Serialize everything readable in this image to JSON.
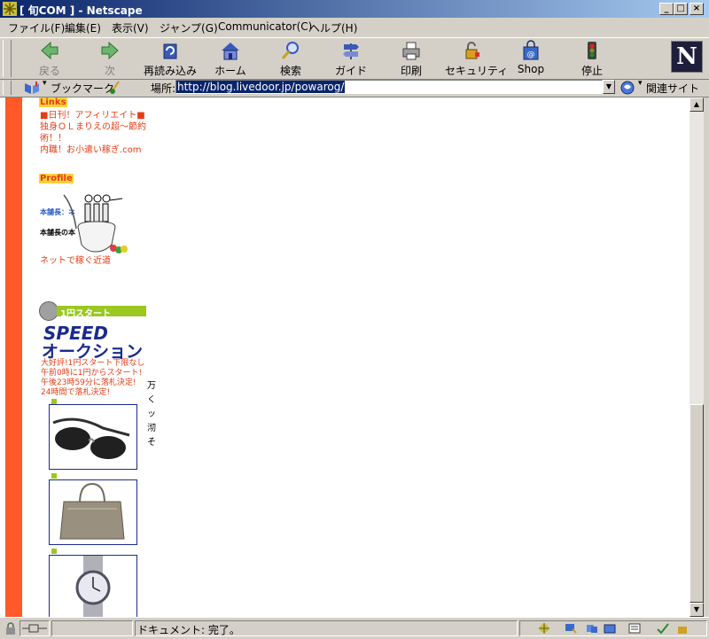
{
  "window": {
    "title": "[ 旬COM ] - Netscape"
  },
  "menu": [
    "ファイル(F)",
    "編集(E)",
    "表示(V)",
    "ジャンプ(G)",
    "Communicator(C)",
    "ヘルプ(H)"
  ],
  "toolbar": {
    "back": "戻る",
    "forward": "次",
    "reload": "再読み込み",
    "home": "ホーム",
    "search": "検索",
    "guide": "ガイド",
    "print": "印刷",
    "security": "セキュリティ",
    "shop": "Shop",
    "stop": "停止",
    "logo": "N"
  },
  "location": {
    "bookmarks": "ブックマーク",
    "label": "場所:",
    "url": "http://blog.livedoor.jp/powarog/",
    "related": "関連サイト"
  },
  "content": {
    "links_header": "Links",
    "links": [
      "■日刊！アフィリエイト■",
      "独身ＯＬまりえの超～節約",
      "術！！",
      "内職！お小遣い稼ぎ.com"
    ],
    "profile_header": "Profile",
    "profile_line1": "本舗長：ネ",
    "profile_line2": "本舗長の本",
    "profile_link": "ネットで稼ぐ近道",
    "auction": {
      "badge": "1円スタート",
      "title1": "SPEED",
      "title2": "オークション",
      "lines": [
        "大好評!1円スタート下限なし",
        "午前0時に1円からスタート!",
        "午後23時59分に落札決定!",
        "24時間で落札決定!"
      ],
      "side": [
        "万",
        "く",
        "ッ",
        "沏",
        "そ"
      ]
    }
  },
  "status": {
    "text": "ドキュメント: 完了。"
  },
  "colors": {
    "sidebar": "#ff5a28",
    "link": "#e63c14",
    "header_bg": "#ffd23c",
    "title_bg": "#0a246a",
    "auction_blue": "#1a2a8c"
  }
}
